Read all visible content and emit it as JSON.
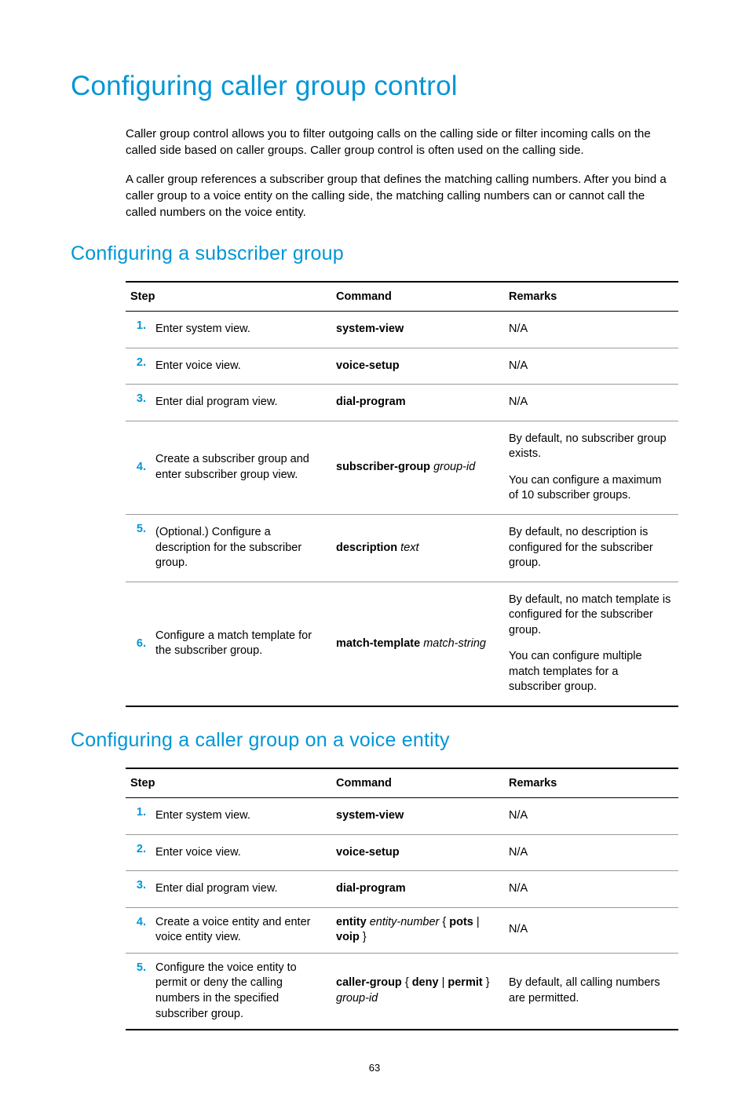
{
  "title": "Configuring caller group control",
  "intro_p1": "Caller group control allows you to filter outgoing calls on the calling side or filter incoming calls on the called side based on caller groups. Caller group control is often used on the calling side.",
  "intro_p2": "A caller group references a subscriber group that defines the matching calling numbers. After you bind a caller group to a voice entity on the calling side, the matching calling numbers can or cannot call the called numbers on the voice entity.",
  "section1": {
    "title": "Configuring a subscriber group",
    "headers": {
      "step": "Step",
      "command": "Command",
      "remarks": "Remarks"
    },
    "rows": [
      {
        "num": "1.",
        "step": "Enter system view.",
        "cmd_b": "system-view",
        "cmd_i": "",
        "remarks": [
          "N/A"
        ]
      },
      {
        "num": "2.",
        "step": "Enter voice view.",
        "cmd_b": "voice-setup",
        "cmd_i": "",
        "remarks": [
          "N/A"
        ]
      },
      {
        "num": "3.",
        "step": "Enter dial program view.",
        "cmd_b": "dial-program",
        "cmd_i": "",
        "remarks": [
          "N/A"
        ]
      },
      {
        "num": "4.",
        "step": "Create a subscriber group and enter subscriber group view.",
        "cmd_b": "subscriber-group",
        "cmd_i": " group-id",
        "remarks": [
          "By default, no subscriber group exists.",
          "You can configure a maximum of 10 subscriber groups."
        ]
      },
      {
        "num": "5.",
        "step": "(Optional.) Configure a description for the subscriber group.",
        "cmd_b": "description",
        "cmd_i": " text",
        "remarks": [
          "By default, no description is configured for the subscriber group."
        ]
      },
      {
        "num": "6.",
        "step": "Configure a match template for the subscriber group.",
        "cmd_b": "match-template",
        "cmd_i": " match-string",
        "remarks": [
          "By default, no match template is configured for the subscriber group.",
          "You can configure multiple match templates for a subscriber group."
        ]
      }
    ]
  },
  "section2": {
    "title": "Configuring a caller group on a voice entity",
    "headers": {
      "step": "Step",
      "command": "Command",
      "remarks": "Remarks"
    },
    "rows": [
      {
        "num": "1.",
        "step": "Enter system view.",
        "cmd_html": "<span class='cmd-b'>system-view</span>",
        "remarks": [
          "N/A"
        ]
      },
      {
        "num": "2.",
        "step": "Enter voice view.",
        "cmd_html": "<span class='cmd-b'>voice-setup</span>",
        "remarks": [
          "N/A"
        ]
      },
      {
        "num": "3.",
        "step": "Enter dial program view.",
        "cmd_html": "<span class='cmd-b'>dial-program</span>",
        "remarks": [
          "N/A"
        ]
      },
      {
        "num": "4.",
        "step": "Create a voice entity and enter voice entity view.",
        "cmd_html": "<span class='cmd-b'>entity</span> <span class='cmd-i'>entity-number</span> { <span class='cmd-b'>pots</span> | <span class='cmd-b'>voip</span> }",
        "remarks": [
          "N/A"
        ]
      },
      {
        "num": "5.",
        "step": "Configure the voice entity to permit or deny the calling numbers in the specified subscriber group.",
        "cmd_html": "<span class='cmd-b'>caller-group</span> { <span class='cmd-b'>deny</span> | <span class='cmd-b'>permit</span> } <span class='cmd-i'>group-id</span>",
        "remarks": [
          "By default, all calling numbers are permitted."
        ]
      }
    ]
  },
  "page_number": "63"
}
